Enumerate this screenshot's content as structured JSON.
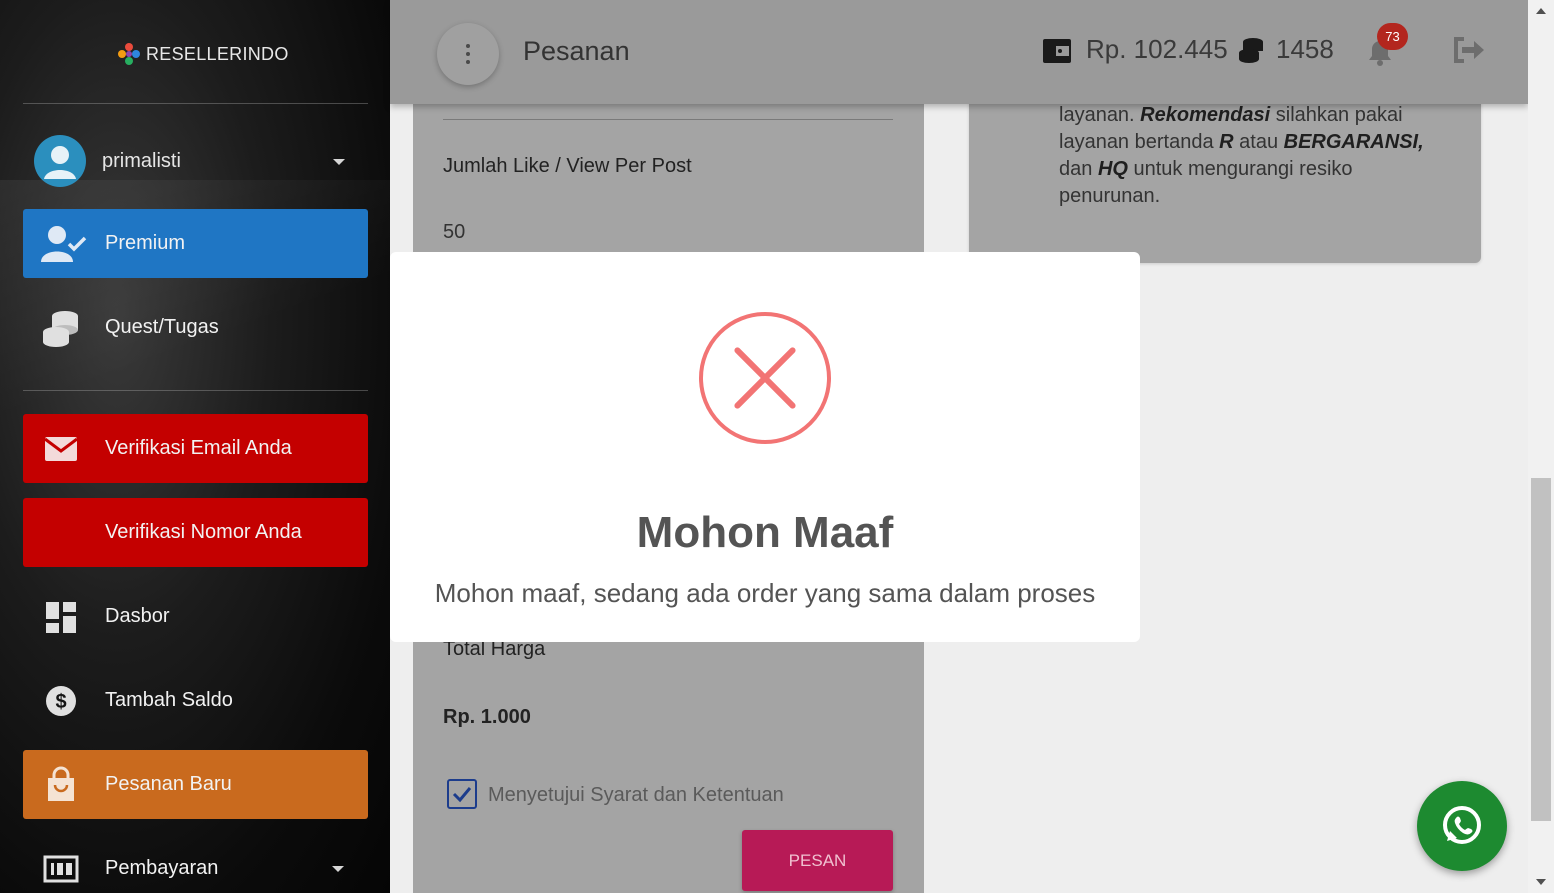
{
  "brand": {
    "name": "RESELLERINDO"
  },
  "user": {
    "name": "primalisti"
  },
  "sidebar": {
    "items": [
      {
        "label": "Premium",
        "icon": "user-check-icon",
        "bg": "#1f76c4"
      },
      {
        "label": "Quest/Tugas",
        "icon": "coins-icon",
        "bg": "transparent"
      },
      {
        "label": "Verifikasi Email Anda",
        "icon": "envelope-icon",
        "bg": "#c40000"
      },
      {
        "label": "Verifikasi Nomor Anda",
        "icon": "",
        "bg": "#c40000"
      },
      {
        "label": "Dasbor",
        "icon": "dashboard-icon",
        "bg": "transparent"
      },
      {
        "label": "Tambah Saldo",
        "icon": "dollar-circle-icon",
        "bg": "transparent"
      },
      {
        "label": "Pesanan Baru",
        "icon": "shopping-bag-icon",
        "bg": "#c96a1e"
      },
      {
        "label": "Pembayaran",
        "icon": "payment-icon",
        "bg": "transparent"
      }
    ]
  },
  "header": {
    "title": "Pesanan",
    "balance": "Rp. 102.445",
    "coins": "1458",
    "notifications": "73"
  },
  "form": {
    "like_label": "Jumlah Like / View Per Post",
    "like_value": "50",
    "total_label": "Total Harga",
    "total_value": "Rp. 1.000",
    "agree_label": "Menyetujui Syarat dan Ketentuan",
    "submit_label": "PESAN"
  },
  "info": {
    "t1": "layanan. ",
    "b1": "Rekomendasi",
    "t2": " silahkan pakai layanan bertanda ",
    "b2": "R",
    "t3": " atau ",
    "b3": "BERGARANSI,",
    "t4": " dan ",
    "b4": "HQ",
    "t5": " untuk mengurangi resiko penurunan."
  },
  "modal": {
    "title": "Mohon Maaf",
    "message": "Mohon maaf, sedang ada order yang sama dalam proses"
  }
}
